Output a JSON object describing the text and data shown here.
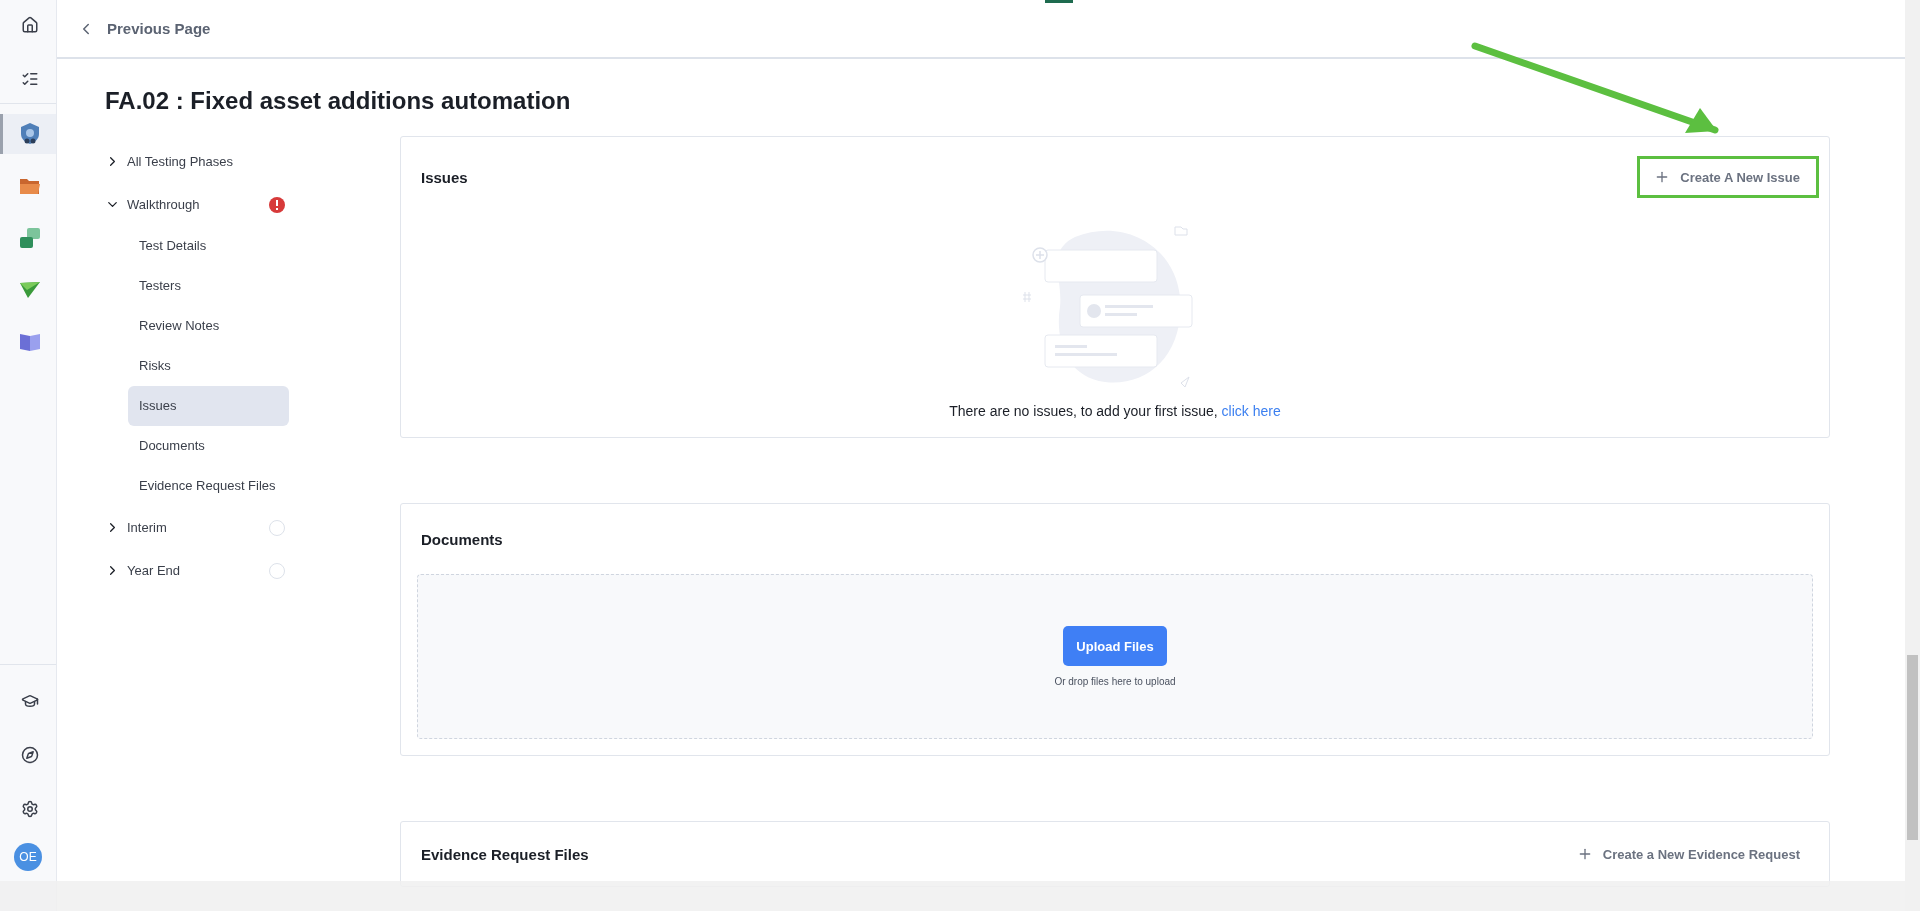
{
  "rail": {
    "top": [
      {
        "kind": "home"
      },
      {
        "kind": "tasks"
      }
    ],
    "apps": [
      {
        "kind": "shield",
        "selected": true
      },
      {
        "kind": "folder",
        "selected": false
      },
      {
        "kind": "swap",
        "selected": false
      },
      {
        "kind": "plane",
        "selected": false
      },
      {
        "kind": "book",
        "selected": false
      }
    ],
    "bottom": [
      {
        "kind": "cap"
      },
      {
        "kind": "compass"
      },
      {
        "kind": "settings"
      }
    ],
    "avatar": "OE"
  },
  "header": {
    "back_label": "Previous Page"
  },
  "title": "FA.02 : Fixed asset additions automation",
  "nav": [
    {
      "label": "All Testing Phases",
      "expanded": false
    },
    {
      "label": "Walkthrough",
      "expanded": true,
      "kind": "alert",
      "children": [
        {
          "label": "Test Details",
          "selected": false
        },
        {
          "label": "Testers",
          "selected": false
        },
        {
          "label": "Review Notes",
          "selected": false
        },
        {
          "label": "Risks",
          "selected": false
        },
        {
          "label": "Issues",
          "selected": true
        },
        {
          "label": "Documents",
          "selected": false
        },
        {
          "label": "Evidence Request Files",
          "selected": false
        }
      ]
    },
    {
      "label": "Interim",
      "expanded": false,
      "kind": "pending"
    },
    {
      "label": "Year End",
      "expanded": false,
      "kind": "pending"
    }
  ],
  "issues": {
    "title": "Issues",
    "action": {
      "label": "Create A New Issue",
      "highlighted": true
    },
    "empty_text": "There are no issues, to add your first issue,",
    "empty_link": "click here"
  },
  "documents": {
    "title": "Documents",
    "upload_label": "Upload Files",
    "hint": "Or drop files here to upload"
  },
  "evidence": {
    "title": "Evidence Request Files",
    "action": {
      "label": "Create a New Evidence Request"
    }
  }
}
